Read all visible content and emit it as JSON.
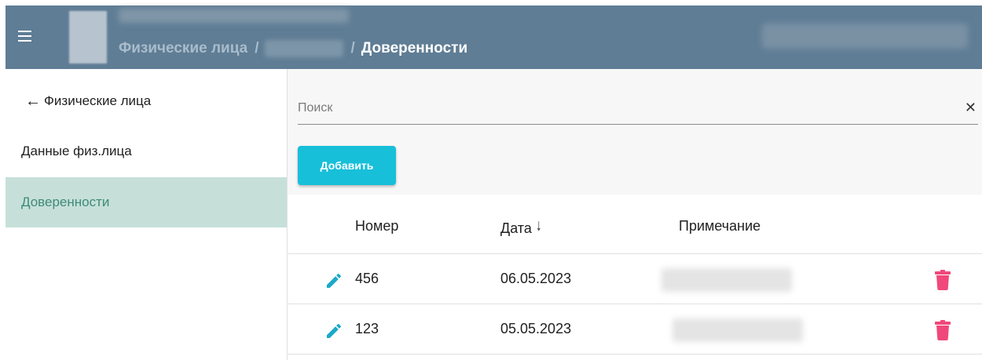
{
  "header": {
    "menu_icon": "menu-icon",
    "breadcrumb": {
      "root": "Физические лица",
      "separator": "/",
      "current": "Доверенности"
    },
    "colors": {
      "background": "#5f7d95",
      "link": "#a9bccb",
      "current": "#ffffff"
    }
  },
  "sidebar": {
    "back_icon": "arrow-left-icon",
    "back_label": "Физические лица",
    "items": [
      {
        "label": "Данные физ.лица",
        "active": false
      },
      {
        "label": "Доверенности",
        "active": true
      }
    ],
    "colors": {
      "active_bg": "#c6e0d9",
      "active_text": "#3f8a78"
    }
  },
  "main": {
    "search": {
      "placeholder": "Поиск",
      "value": "",
      "clear_icon": "close-icon"
    },
    "add_button": {
      "label": "Добавить",
      "color": "#17bfd9"
    },
    "table": {
      "columns": [
        {
          "key": "number",
          "label": "Номер"
        },
        {
          "key": "date",
          "label": "Дата",
          "sort": "descending",
          "sort_icon": "arrow-down-icon"
        },
        {
          "key": "note",
          "label": "Примечание"
        }
      ],
      "rows": [
        {
          "number": "456",
          "date": "06.05.2023"
        },
        {
          "number": "123",
          "date": "05.05.2023"
        }
      ],
      "row_actions": {
        "edit_icon": "pencil-icon",
        "edit_color": "#1ba9c9",
        "delete_icon": "trash-icon",
        "delete_color": "#f0487a"
      }
    }
  }
}
